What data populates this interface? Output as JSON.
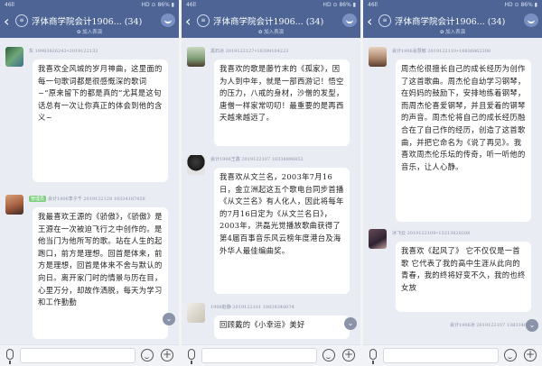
{
  "status": {
    "left": "46ll",
    "right": "HD ⊙ 86% ▮"
  },
  "group": {
    "title": "浮体商学院会计1906...",
    "count": "(34)",
    "subtitle": "✿ 加入表演",
    "badge_icon": "≡"
  },
  "phones": [
    {
      "messages": [
        {
          "meta": "东 19983826243•2019122133",
          "text": "我喜欢全风城的岁月神曲，这里面的每一句歌词都是很感慨深的歌词~“原来留下的都是真的”尤其是这句话总有一次让你真正的体会到他的含义~"
        },
        {
          "badge": "管理员",
          "meta": "会计1906李子千 2019122128 18334187458",
          "text": "我最喜欢王源的《骄傲》，《骄傲》是王源在一次被迫飞行之中创作的。是他当门为他所写的歌。站在人生的起跑口，前方是理想。回首是体来，前方是理想，回首是体来不舍与默认的向日。离开家门时的情景与历在目，心里万分，却故作洒脱，每天为学习和工作勤勤"
        }
      ]
    },
    {
      "messages": [
        {
          "meta": "黑石冰 2019122127•18398104223",
          "text": "我喜欢的歌是藤竹末的《孤家》，因为人到中年，就是一部西游记！悟空的压力，八戒的身材，沙僧的发型，唐僧一样家常叨叨！最重要的是再西天越来越远了。"
        },
        {
          "meta": "会计1906王鑫 2019122107 18338896852",
          "text": "我喜欢从文兰名，2003年7月16日，金立洲起这五个歌电台同步首播《从文兰名》有人化人，因此将每年的7月16日定为《从文兰名日》，2003年，洪磊光觉播放歌曲获得了第4届百事音乐风云榜年度港台及海外华人最佳编曲奖。"
        },
        {
          "meta": "1906赵静 2019122101 18838348074",
          "text": "回顾戴的《小幸运》美好"
        }
      ]
    },
    {
      "messages": [
        {
          "meta": "会计1906会慧敏 2019122110•18836862308",
          "text": "周杰伦很擅长自己的成长经历为创作了这首歌曲。周杰伦自幼学习钢琴，在妈妈的鼓励下，安排地练着钢琴，而周杰伦喜爱钢琴，并且爱着的钢琴的声音。周杰伦将自己的成长经历融合在了自己作的经历，创造了这首歌曲，并把它命名为《说了再见》。我喜欢周杰伦乐坛的传奇，听一听他的音乐，让人心静。"
        },
        {
          "meta": "冰飞云 2019122109•13213829208",
          "text": "我喜欢《起风了》 它不仅仅是一首歌 它代表了我的高中生涯从此向的青春，我的终将好变不久，我的也终女放"
        },
        {
          "meta": "会计1906冰 2019122107 13833461348",
          "text": ""
        }
      ]
    }
  ],
  "colors": {
    "header": "#4d6494",
    "bubble": "#ffffff",
    "background": "#e9ecf3",
    "badge": "#7dcf7f"
  },
  "icons": {
    "back": "chevron-left-icon",
    "mic": "microphone-icon",
    "emoji": "emoji-icon",
    "plus": "plus-icon",
    "scroll": "chevron-down-icon",
    "menu": "group-menu-icon"
  }
}
